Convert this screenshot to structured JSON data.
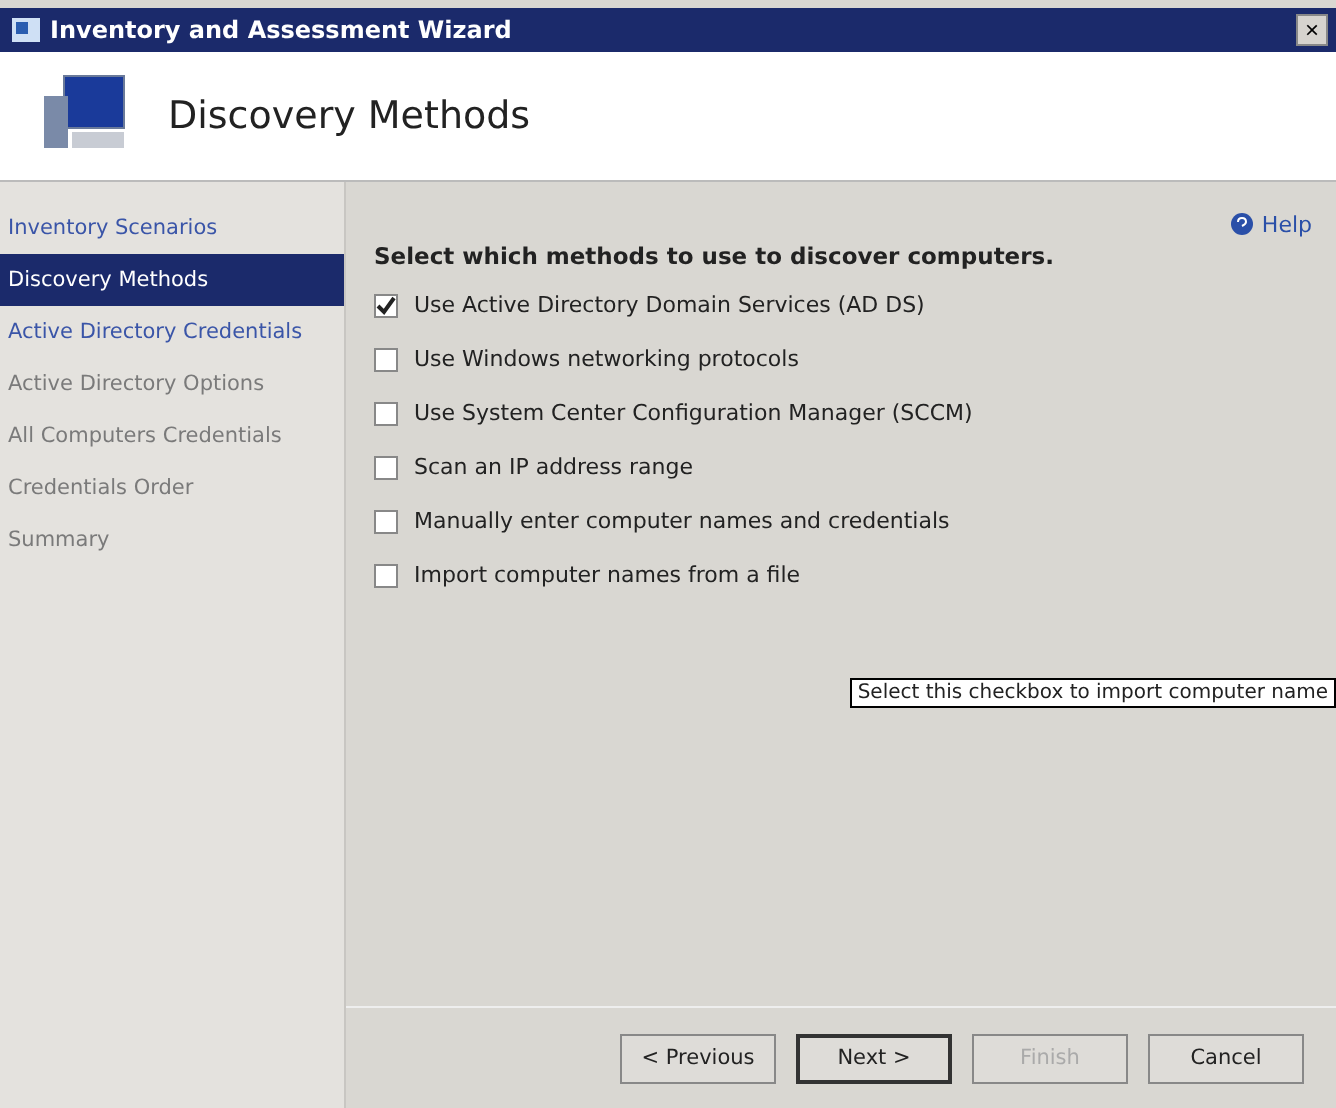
{
  "window": {
    "title": "Inventory and Assessment Wizard",
    "close": "×"
  },
  "header": {
    "title": "Discovery Methods"
  },
  "sidebar": {
    "items": [
      {
        "label": "Inventory Scenarios",
        "selected": false,
        "enabled": true
      },
      {
        "label": "Discovery Methods",
        "selected": true,
        "enabled": true
      },
      {
        "label": "Active Directory Credentials",
        "selected": false,
        "enabled": true
      },
      {
        "label": "Active Directory Options",
        "selected": false,
        "enabled": false
      },
      {
        "label": "All Computers Credentials",
        "selected": false,
        "enabled": false
      },
      {
        "label": "Credentials Order",
        "selected": false,
        "enabled": false
      },
      {
        "label": "Summary",
        "selected": false,
        "enabled": false
      }
    ]
  },
  "help": {
    "label": "Help"
  },
  "prompt": "Select which methods to use to discover computers.",
  "methods": [
    {
      "label": "Use Active Directory Domain Services (AD DS)",
      "checked": true
    },
    {
      "label": "Use Windows networking protocols",
      "checked": false
    },
    {
      "label": "Use System Center Configuration Manager (SCCM)",
      "checked": false
    },
    {
      "label": "Scan an IP address range",
      "checked": false
    },
    {
      "label": "Manually enter computer names and credentials",
      "checked": false
    },
    {
      "label": "Import computer names from a file",
      "checked": false
    }
  ],
  "tooltip": "Select this checkbox to import computer name",
  "buttons": [
    {
      "label": "< Previous",
      "disabled": false,
      "default": false
    },
    {
      "label": "Next >",
      "disabled": false,
      "default": true
    },
    {
      "label": "Finish",
      "disabled": true,
      "default": false
    },
    {
      "label": "Cancel",
      "disabled": false,
      "default": false
    }
  ]
}
